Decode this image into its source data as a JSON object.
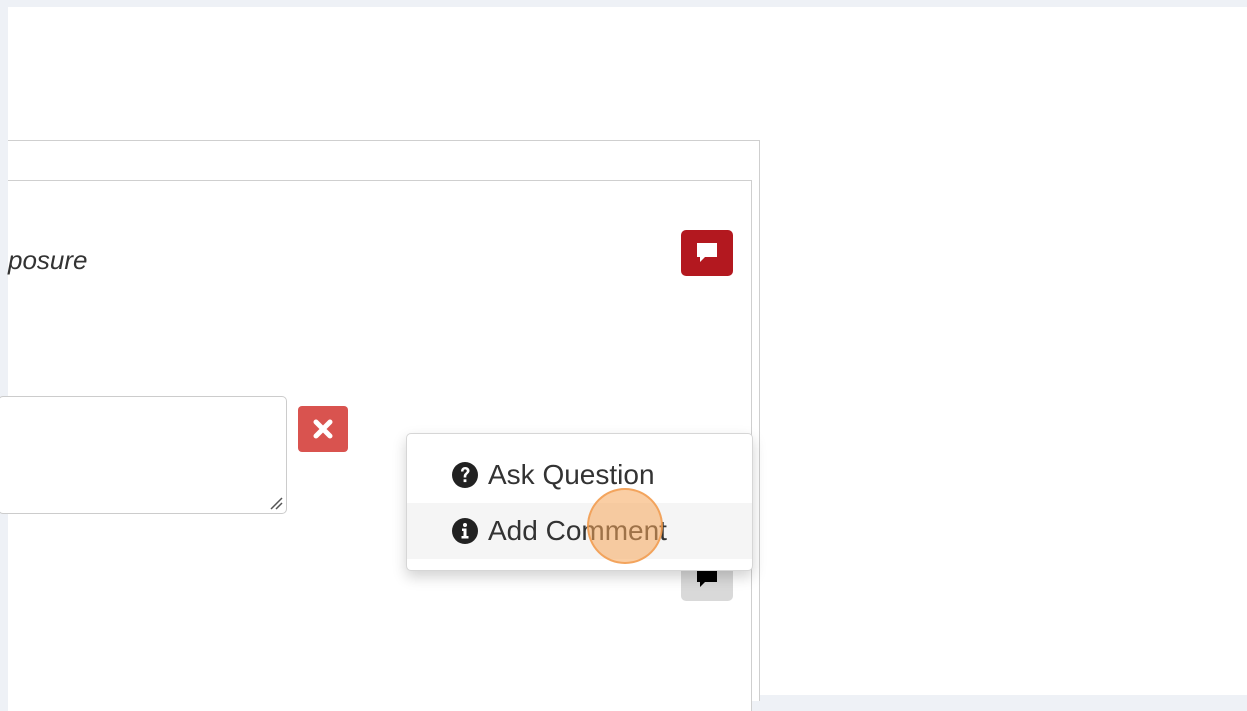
{
  "question": {
    "text_fragment": "posure"
  },
  "context_menu": {
    "items": [
      {
        "label": "Ask Question",
        "icon": "question-circle-icon"
      },
      {
        "label": "Add Comment",
        "icon": "info-circle-icon"
      }
    ]
  },
  "colors": {
    "comment_active": "#b3181f",
    "remove_button": "#d9534f",
    "comment_inactive": "#d9d9d9",
    "click_indicator": "#f5a65a"
  }
}
